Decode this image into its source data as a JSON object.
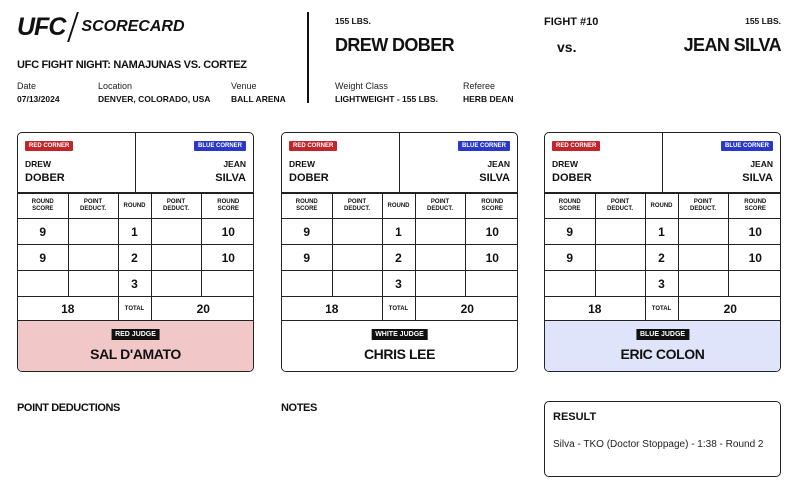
{
  "header": {
    "logo_ufc": "UFC",
    "logo_scorecard": "SCORECARD",
    "event": "UFC FIGHT NIGHT: NAMAJUNAS VS. CORTEZ",
    "date_label": "Date",
    "date": "07/13/2024",
    "location_label": "Location",
    "location": "DENVER, COLORADO, USA",
    "venue_label": "Venue",
    "venue": "BALL ARENA"
  },
  "fight": {
    "red_weight": "155 LBS.",
    "red_name": "DREW DOBER",
    "fight_number": "FIGHT #10",
    "vs": "vs.",
    "blue_weight": "155 LBS.",
    "blue_name": "JEAN SILVA",
    "weight_class_label": "Weight Class",
    "weight_class": "LIGHTWEIGHT - 155 LBS.",
    "referee_label": "Referee",
    "referee": "HERB DEAN"
  },
  "labels": {
    "red_corner": "RED CORNER",
    "blue_corner": "BLUE CORNER",
    "red_first": "DREW",
    "red_last": "DOBER",
    "blue_first": "JEAN",
    "blue_last": "SILVA",
    "round_score_1": "ROUND",
    "round_score_2": "SCORE",
    "point_deduct_1": "POINT",
    "point_deduct_2": "DEDUCT.",
    "round": "ROUND",
    "total": "TOTAL"
  },
  "cards": [
    {
      "judge_badge": "RED JUDGE",
      "judge_name": "SAL D'AMATO",
      "judge_color": "#f2c7c7",
      "rows": [
        {
          "round": "1",
          "red": "9",
          "red_ded": "",
          "blue_ded": "",
          "blue": "10"
        },
        {
          "round": "2",
          "red": "9",
          "red_ded": "",
          "blue_ded": "",
          "blue": "10"
        },
        {
          "round": "3",
          "red": "",
          "red_ded": "",
          "blue_ded": "",
          "blue": ""
        }
      ],
      "red_total": "18",
      "blue_total": "20"
    },
    {
      "judge_badge": "WHITE JUDGE",
      "judge_name": "CHRIS LEE",
      "judge_color": "#ffffff",
      "rows": [
        {
          "round": "1",
          "red": "9",
          "red_ded": "",
          "blue_ded": "",
          "blue": "10"
        },
        {
          "round": "2",
          "red": "9",
          "red_ded": "",
          "blue_ded": "",
          "blue": "10"
        },
        {
          "round": "3",
          "red": "",
          "red_ded": "",
          "blue_ded": "",
          "blue": ""
        }
      ],
      "red_total": "18",
      "blue_total": "20"
    },
    {
      "judge_badge": "BLUE JUDGE",
      "judge_name": "ERIC COLON",
      "judge_color": "#dfe4fa",
      "rows": [
        {
          "round": "1",
          "red": "9",
          "red_ded": "",
          "blue_ded": "",
          "blue": "10"
        },
        {
          "round": "2",
          "red": "9",
          "red_ded": "",
          "blue_ded": "",
          "blue": "10"
        },
        {
          "round": "3",
          "red": "",
          "red_ded": "",
          "blue_ded": "",
          "blue": ""
        }
      ],
      "red_total": "18",
      "blue_total": "20"
    }
  ],
  "sections": {
    "point_deductions": "POINT DEDUCTIONS",
    "notes": "NOTES",
    "result_title": "RESULT",
    "result_text": "Silva - TKO (Doctor Stoppage) - 1:38 - Round 2"
  },
  "colors": {
    "red_corner": "#c0262c",
    "blue_corner": "#2a38c8"
  }
}
